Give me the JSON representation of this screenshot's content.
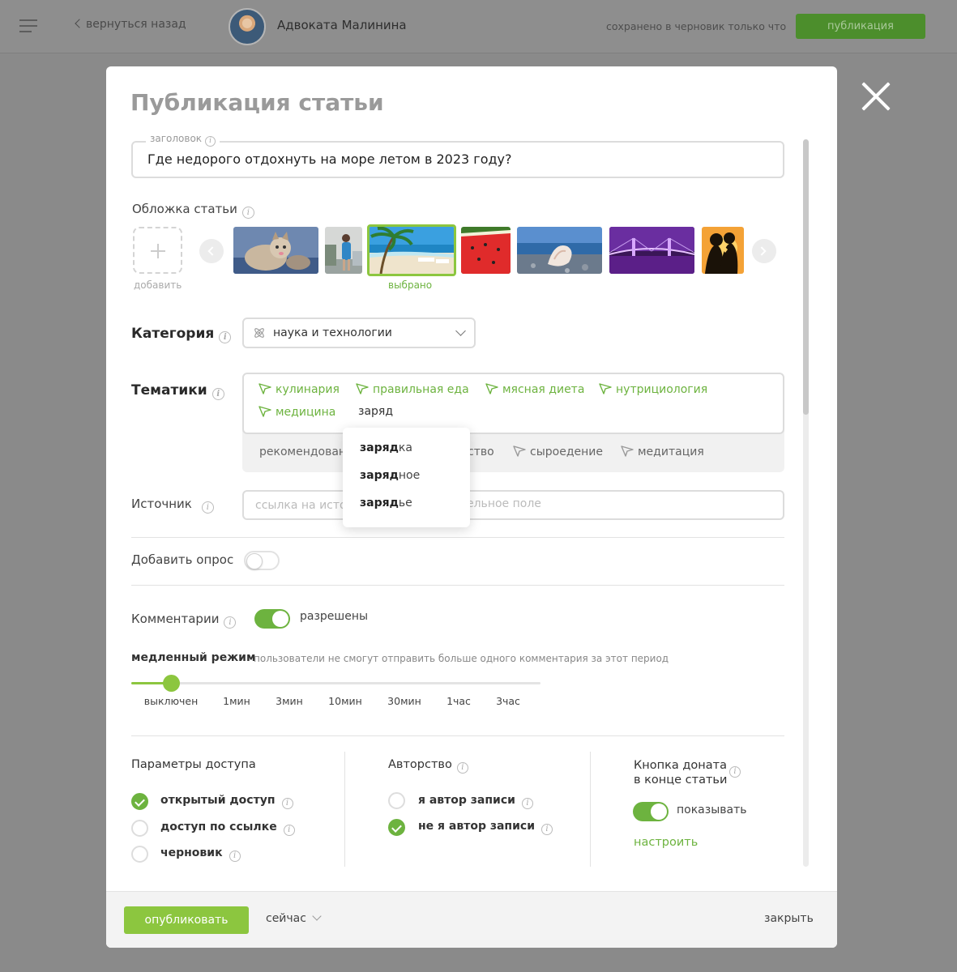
{
  "topbar": {
    "back_label": "вернуться назад",
    "author_name": "Адвоката Малинина",
    "saved_status": "сохранено в черновик только что",
    "publish_label": "публикация"
  },
  "modal": {
    "title": "Публикация статьи",
    "title_field": {
      "legend": "заголовок",
      "value": "Где недорого отдохнуть на море летом в 2023 году?"
    },
    "cover": {
      "label": "Обложка статьи",
      "add_label": "добавить",
      "selected_label": "выбрано",
      "thumbnails": [
        "cat",
        "woman-by-car",
        "beach-palm",
        "watermelon",
        "seashell",
        "purple-bridge",
        "couple-sunset"
      ],
      "selected_index": 2
    },
    "category": {
      "label": "Категория",
      "value": "наука и технологии"
    },
    "topics": {
      "label": "Тематики",
      "tags": [
        "кулинария",
        "правильная еда",
        "мясная диета",
        "нутрициология",
        "медицина"
      ],
      "input_value": "заряд",
      "recommended_prefix": "рекомендован",
      "recommended_partial": "ство",
      "recommended": [
        "сыроедение",
        "медитация"
      ],
      "suggestions": [
        {
          "match": "заряд",
          "rest": "ка"
        },
        {
          "match": "заряд",
          "rest": "ное"
        },
        {
          "match": "заряд",
          "rest": "ье"
        }
      ]
    },
    "source": {
      "label": "Источник",
      "placeholder_start": "ссылка на исто",
      "placeholder_end": "ельное поле"
    },
    "poll": {
      "label": "Добавить опрос",
      "enabled": false
    },
    "comments": {
      "label": "Комментарии",
      "enabled": true,
      "state_label": "разрешены"
    },
    "slow_mode": {
      "title": "медленный режим",
      "description": "пользователи не смогут отправить больше одного комментария за этот период",
      "options": [
        "выключен",
        "1мин",
        "3мин",
        "10мин",
        "30мин",
        "1час",
        "3час"
      ],
      "selected_index": 0
    },
    "access": {
      "title": "Параметры доступа",
      "options": [
        "открытый доступ",
        "доступ по ссылке",
        "черновик"
      ],
      "selected_index": 0
    },
    "authorship": {
      "title": "Авторство",
      "options": [
        "я автор записи",
        "не я автор записи"
      ],
      "selected_index": 1
    },
    "donate": {
      "title_line1": "Кнопка доната",
      "title_line2": "в конце статьи",
      "enabled": true,
      "state_label": "показывать",
      "setup_label": "настроить"
    },
    "footer": {
      "publish_label": "опубликовать",
      "when_label": "сейчас",
      "close_label": "закрыть"
    }
  },
  "colors": {
    "accent": "#8cc63f",
    "accent_text": "#6db33f",
    "overlay": "#8a8a8a"
  }
}
